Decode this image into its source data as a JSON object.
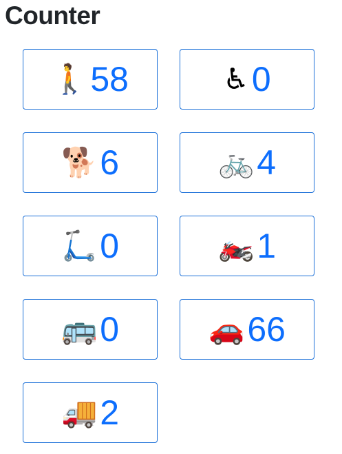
{
  "page": {
    "title": "Counter"
  },
  "counters": [
    {
      "emoji": "🚶",
      "icon": "pedestrian-icon",
      "count": "58"
    },
    {
      "emoji": "♿",
      "icon": "wheelchair-icon",
      "count": "0"
    },
    {
      "emoji": "🐕",
      "icon": "dog-icon",
      "count": "6"
    },
    {
      "emoji": "🚲",
      "icon": "bicycle-icon",
      "count": "4"
    },
    {
      "emoji": "🛴",
      "icon": "scooter-icon",
      "count": "0"
    },
    {
      "emoji": "🏍️",
      "icon": "motorcycle-icon",
      "count": "1"
    },
    {
      "emoji": "🚌",
      "icon": "bus-icon",
      "count": "0"
    },
    {
      "emoji": "🚗",
      "icon": "car-icon",
      "count": "66"
    },
    {
      "emoji": "🚚",
      "icon": "truck-icon",
      "count": "2"
    }
  ],
  "colors": {
    "accent": "#0d6efd",
    "border": "#1a6fd8",
    "title": "#212529"
  }
}
